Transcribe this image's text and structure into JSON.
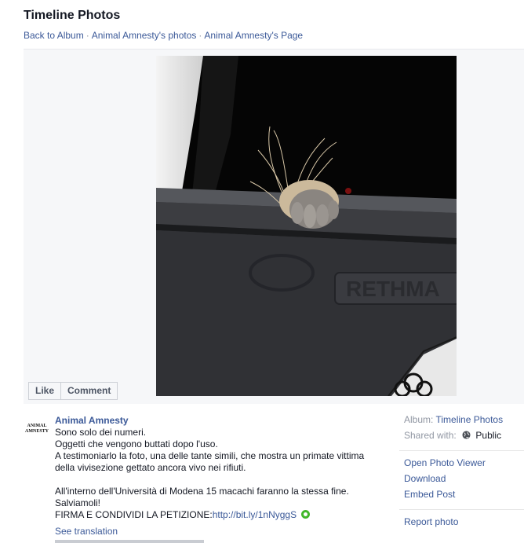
{
  "header": {
    "title": "Timeline Photos",
    "breadcrumb": {
      "back": "Back to Album",
      "sep": "·",
      "photos": "Animal Amnesty's photos",
      "page": "Animal Amnesty's Page"
    }
  },
  "photo": {
    "plate_text": "RETHMA"
  },
  "actions": {
    "like": "Like",
    "comment": "Comment"
  },
  "post": {
    "logo_text_1": "ANIMAL",
    "logo_text_2": "AMNESTY",
    "author": "Animal Amnesty",
    "lines": [
      "Sono solo dei numeri.",
      "Oggetti che vengono buttati dopo l'uso.",
      "A testimoniarlo la foto, una delle tante simili, che mostra un primate vittima",
      "della vivisezione gettato ancora vivo nei rifiuti."
    ],
    "lines2": [
      "All'interno dell'Università di Modena 15 macachi faranno la stessa fine.",
      "Salviamoli!"
    ],
    "petition_label": "FIRMA E CONDIVIDI LA PETIZIONE:",
    "petition_link": "http://bit.ly/1nNyggS",
    "see_translation": "See translation"
  },
  "sidebar": {
    "album_label": "Album:",
    "album_value": "Timeline Photos",
    "shared_label": "Shared with:",
    "shared_value": "Public",
    "links": [
      "Open Photo Viewer",
      "Download",
      "Embed Post"
    ],
    "report": "Report photo"
  },
  "colors": {
    "link": "#3b5998",
    "stage_bg": "#f6f7f9",
    "text": "#141823",
    "muted": "#9197a3"
  }
}
